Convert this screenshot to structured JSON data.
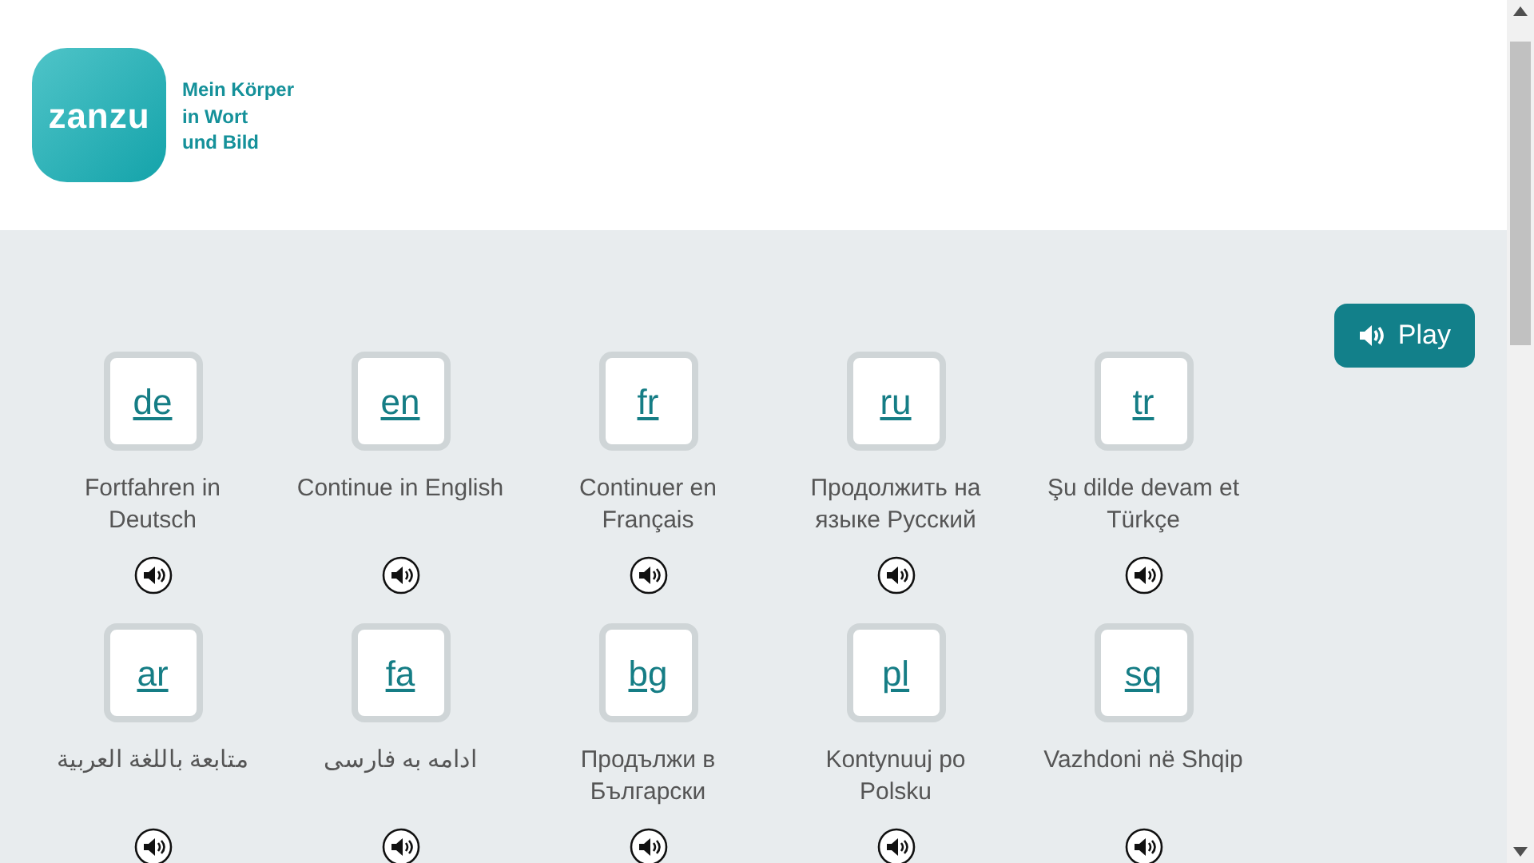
{
  "logo": {
    "wordmark": "zanzu",
    "tagline": [
      "Mein Körper",
      "in Wort",
      "und Bild"
    ]
  },
  "play_button": {
    "label": "Play"
  },
  "languages": [
    {
      "code": "de",
      "label": "Fortfahren in Deutsch"
    },
    {
      "code": "en",
      "label": "Continue in English"
    },
    {
      "code": "fr",
      "label": "Continuer en Français"
    },
    {
      "code": "ru",
      "label": "Продолжить на языке Русский"
    },
    {
      "code": "tr",
      "label": "Şu dilde devam et Türkçe"
    },
    {
      "code": "ar",
      "label": "متابعة باللغة العربية"
    },
    {
      "code": "fa",
      "label": "ادامه به فارسی"
    },
    {
      "code": "bg",
      "label": "Продължи в Български"
    },
    {
      "code": "pl",
      "label": "Kontynuuj po Polsku"
    },
    {
      "code": "sq",
      "label": "Vazhdoni në Shqip"
    }
  ]
}
